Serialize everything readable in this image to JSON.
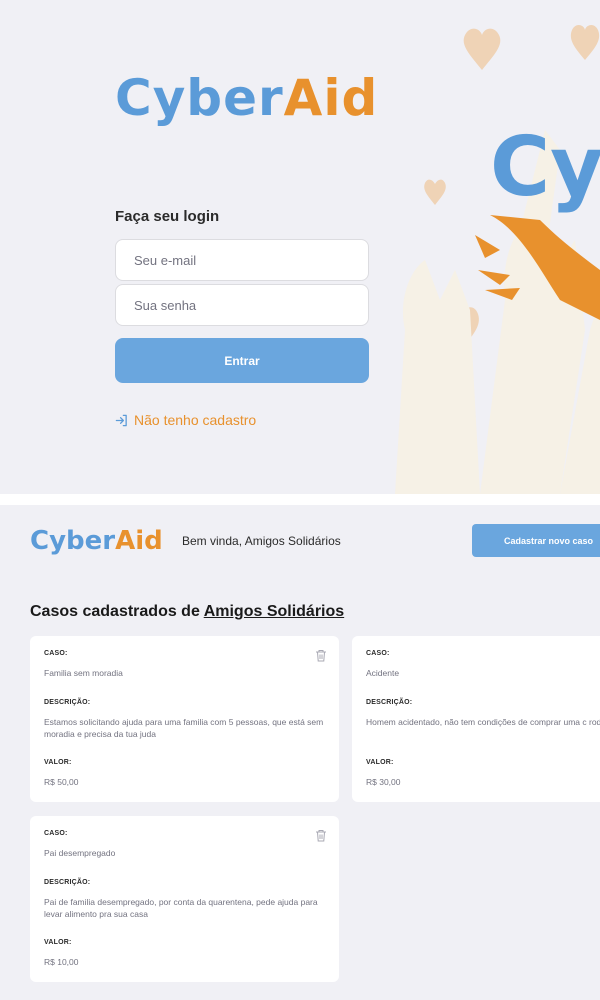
{
  "login": {
    "logo": {
      "part1": "Cyber",
      "part2": "Aid"
    },
    "title": "Faça seu login",
    "email_placeholder": "Seu e-mail",
    "password_placeholder": "Sua senha",
    "submit_label": "Entrar",
    "register_link": "Não tenho cadastro",
    "hero_text": "Cy"
  },
  "profile": {
    "logo": {
      "part1": "Cyber",
      "part2": "Aid"
    },
    "welcome": "Bem vinda, Amigos Solidários",
    "new_case_button": "Cadastrar novo caso",
    "title_prefix": "Casos cadastrados de ",
    "title_org": "Amigos Solidários",
    "labels": {
      "case": "CASO:",
      "description": "DESCRIÇÃO:",
      "value": "VALOR:"
    },
    "cases": [
      {
        "case": "Familia sem moradia",
        "description": "Estamos solicitando ajuda para uma familia com 5 pessoas, que está sem moradia e precisa da tua juda",
        "value": "R$ 50,00"
      },
      {
        "case": "Acidente",
        "description": "Homem acidentado, não tem condições de comprar uma c rodas",
        "value": "R$ 30,00"
      },
      {
        "case": "Pai desempregado",
        "description": "Pai de familia desempregado, por conta da quarentena, pede ajuda para levar alimento pra sua casa",
        "value": "R$ 10,00"
      }
    ]
  },
  "colors": {
    "accent_blue": "#6aa6de",
    "brand_orange": "#e8912d",
    "background": "#f0f0f5"
  },
  "icons": {
    "login_icon": "log-in-icon",
    "delete_icon": "trash-icon"
  }
}
